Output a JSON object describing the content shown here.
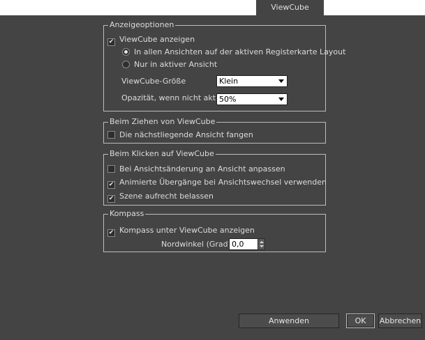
{
  "tab": {
    "label": "ViewCube"
  },
  "display_options": {
    "title": "Anzeigeoptionen",
    "show_viewcube": {
      "label": "ViewCube anzeigen",
      "checked": true
    },
    "radio_all_views": {
      "label": "In allen Ansichten auf der aktiven Registerkarte Layout",
      "selected": true
    },
    "radio_active_view": {
      "label": "Nur in aktiver Ansicht",
      "selected": false
    },
    "size": {
      "label": "ViewCube-Größe",
      "value": "Klein"
    },
    "opacity": {
      "label": "Opazität, wenn nicht aktiv",
      "value": "50%"
    }
  },
  "drag": {
    "title": "Beim Ziehen von ViewCube",
    "snap_nearest": {
      "label": "Die nächstliegende Ansicht fangen",
      "checked": false
    }
  },
  "click": {
    "title": "Beim Klicken auf ViewCube",
    "fit_to_view": {
      "label": "Bei Ansichtsänderung an Ansicht anpassen",
      "checked": false
    },
    "animated_transitions": {
      "label": "Animierte Übergänge bei Ansichtswechsel verwenden",
      "checked": true
    },
    "keep_upright": {
      "label": "Szene aufrecht belassen",
      "checked": true
    }
  },
  "compass": {
    "title": "Kompass",
    "show_compass": {
      "label": "Kompass unter ViewCube anzeigen",
      "checked": true
    },
    "north_angle": {
      "label": "Nordwinkel (Grad):",
      "value": "0,0"
    }
  },
  "buttons": {
    "apply": "Anwenden",
    "ok": "OK",
    "cancel": "Abbrechen"
  },
  "colors": {
    "background": "#444444",
    "tabbar": "#ffffff",
    "border": "#bdbdbd"
  }
}
